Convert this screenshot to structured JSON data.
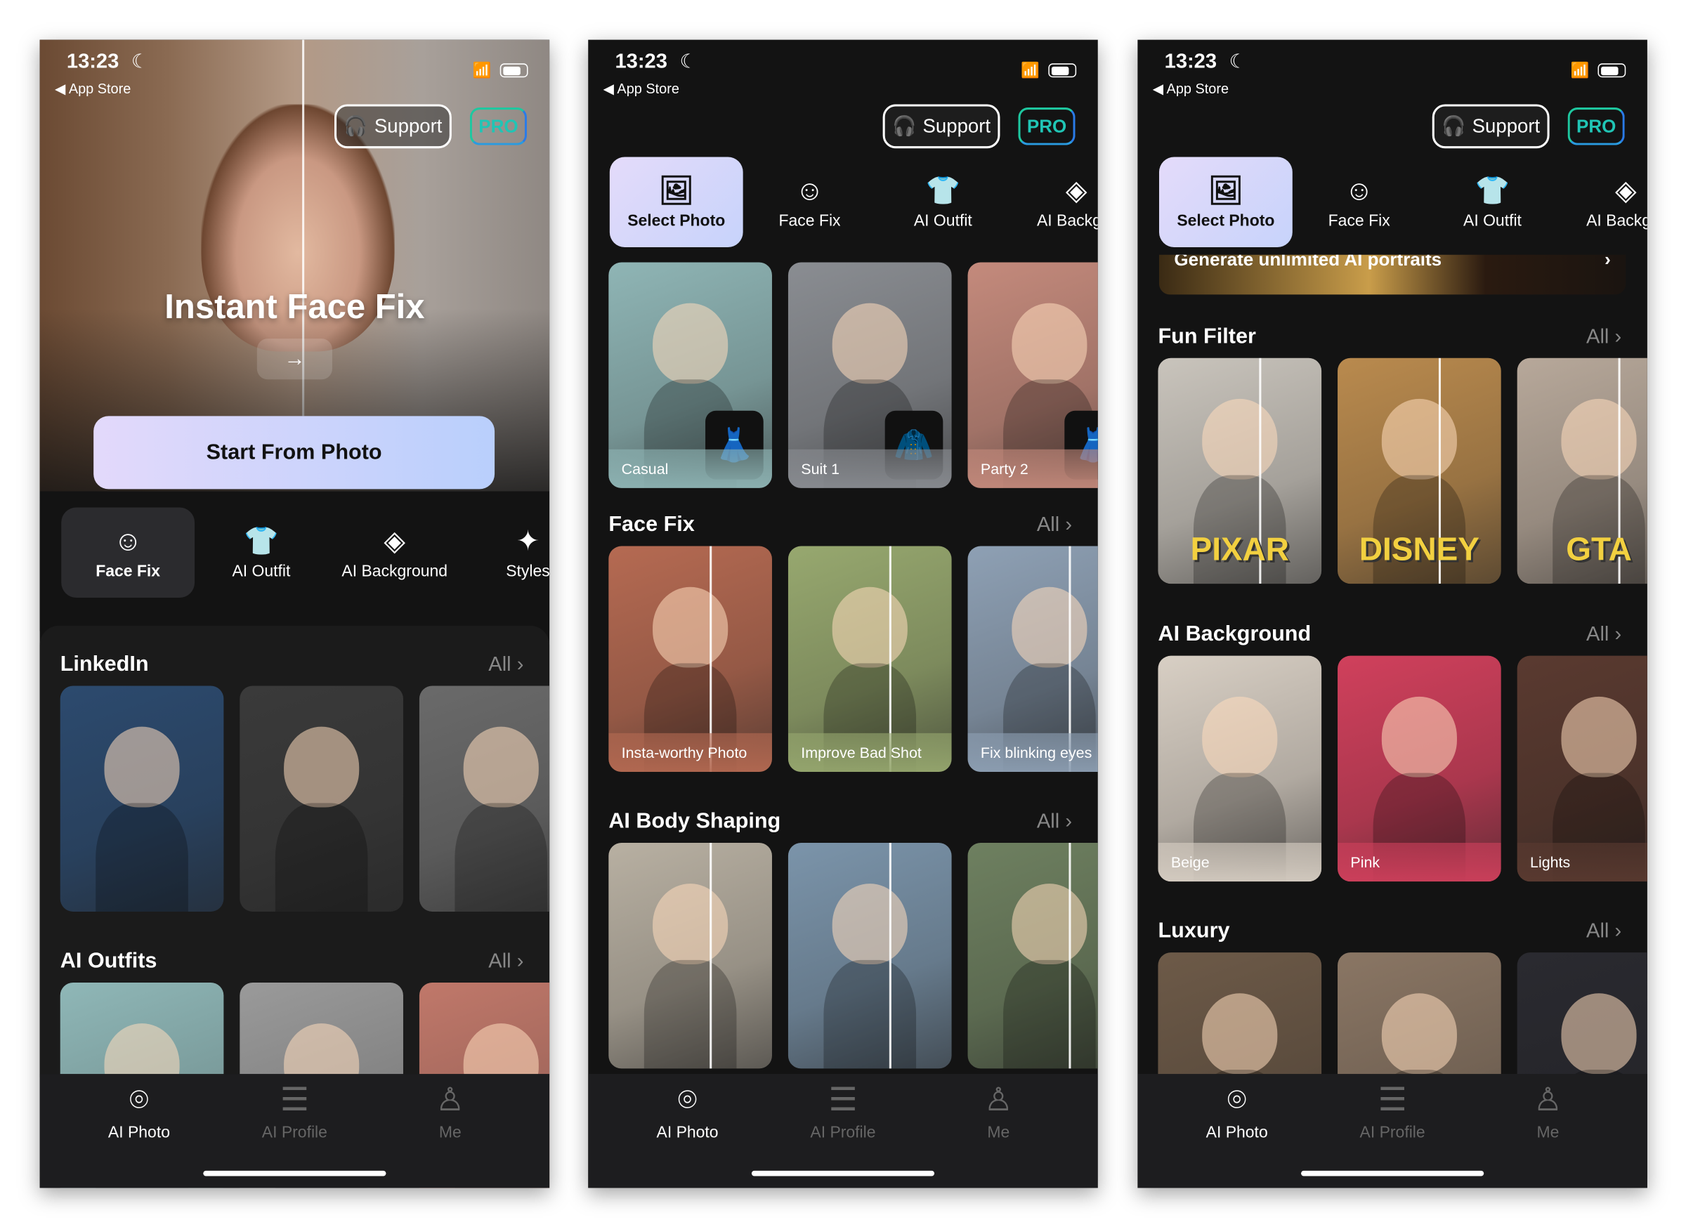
{
  "status": {
    "time": "13:23",
    "back_label": "App Store"
  },
  "header": {
    "support_label": "Support",
    "pro_label": "PRO"
  },
  "nav": [
    {
      "label": "AI Photo",
      "icon": "face-scan-icon",
      "active": true
    },
    {
      "label": "AI Profile",
      "icon": "stack-icon",
      "active": false
    },
    {
      "label": "Me",
      "icon": "person-icon",
      "active": false
    }
  ],
  "colors": {
    "accent_start": "#e3d9fb",
    "accent_end": "#b9cffc",
    "pro_green": "#1ec8a0",
    "pro_blue": "#2a7be8",
    "background": "#131313"
  },
  "screen1": {
    "hero_title": "Instant Face Fix",
    "hero_arrow": "→",
    "start_button": "Start From Photo",
    "tabs": [
      {
        "label": "Face Fix",
        "icon": "face-sparkle-icon",
        "glyph": "☺",
        "active": true
      },
      {
        "label": "AI Outfit",
        "icon": "shirt-icon",
        "glyph": "👕",
        "active": false
      },
      {
        "label": "AI Background",
        "icon": "layers-icon",
        "glyph": "◈",
        "active": false
      },
      {
        "label": "Styles",
        "icon": "sparkles-icon",
        "glyph": "✦",
        "active": false
      }
    ],
    "sections": [
      {
        "title": "LinkedIn",
        "all_label": "All",
        "cards": [
          {
            "label": "",
            "color": "#2c4a6e"
          },
          {
            "label": "",
            "color": "#3a3a3a"
          },
          {
            "label": "",
            "color": "#6a6a6a"
          }
        ]
      },
      {
        "title": "AI Outfits",
        "all_label": "All",
        "cards": [
          {
            "label": "",
            "color": "#8fb7b7"
          },
          {
            "label": "",
            "color": "#9a9a9a"
          },
          {
            "label": "",
            "color": "#c0786a"
          }
        ]
      }
    ]
  },
  "screen2": {
    "tabs": [
      {
        "label": "Select Photo",
        "icon": "image-icon",
        "glyph": "🖼",
        "active": true
      },
      {
        "label": "Face Fix",
        "icon": "face-sparkle-icon",
        "glyph": "☺",
        "active": false
      },
      {
        "label": "AI Outfit",
        "icon": "shirt-icon",
        "glyph": "👕",
        "active": false
      },
      {
        "label": "AI Backgro",
        "icon": "layers-icon",
        "glyph": "◈",
        "active": false
      }
    ],
    "top_cards": [
      {
        "label": "Casual",
        "color": "#8fb5b5",
        "thumb": "dress-icon"
      },
      {
        "label": "Suit 1",
        "color": "#8a8d92",
        "thumb": "suit-icon"
      },
      {
        "label": "Party 2",
        "color": "#c48a7c",
        "thumb": "dress-icon"
      }
    ],
    "sections": [
      {
        "title": "Face Fix",
        "all_label": "All",
        "cards": [
          {
            "label": "Insta-worthy Photo",
            "color": "#b56a52"
          },
          {
            "label": "Improve Bad Shot",
            "color": "#97a86f"
          },
          {
            "label": "Fix blinking eyes",
            "color": "#8ea0b4"
          }
        ]
      },
      {
        "title": "AI Body Shaping",
        "all_label": "All",
        "cards": [
          {
            "label": "",
            "color": "#b8b0a2"
          },
          {
            "label": "",
            "color": "#7b94aa"
          },
          {
            "label": "",
            "color": "#6e8060"
          }
        ]
      }
    ]
  },
  "screen3": {
    "tabs": [
      {
        "label": "Select Photo",
        "icon": "image-icon",
        "glyph": "🖼",
        "active": true
      },
      {
        "label": "Face Fix",
        "icon": "face-sparkle-icon",
        "glyph": "☺",
        "active": false
      },
      {
        "label": "AI Outfit",
        "icon": "shirt-icon",
        "glyph": "👕",
        "active": false
      },
      {
        "label": "AI Backgro",
        "icon": "layers-icon",
        "glyph": "◈",
        "active": false
      }
    ],
    "banner_text": "Generate unlimited AI portraits",
    "sections": [
      {
        "title": "Fun Filter",
        "all_label": "All",
        "cards": [
          {
            "label": "",
            "brand": "PIXAR",
            "color": "#c9c4bc"
          },
          {
            "label": "",
            "brand": "DISNEY",
            "color": "#b98a4e"
          },
          {
            "label": "",
            "brand": "GTA",
            "color": "#b7a89a"
          }
        ]
      },
      {
        "title": "AI Background",
        "all_label": "All",
        "cards": [
          {
            "label": "Beige",
            "color": "#d8cfc4"
          },
          {
            "label": "Pink",
            "color": "#d0405c"
          },
          {
            "label": "Lights",
            "color": "#5a3a30"
          }
        ]
      },
      {
        "title": "Luxury",
        "all_label": "All",
        "cards": [
          {
            "label": "",
            "color": "#6d5a48"
          },
          {
            "label": "",
            "color": "#8a7664"
          },
          {
            "label": "",
            "color": "#2a2a30"
          }
        ]
      }
    ]
  }
}
